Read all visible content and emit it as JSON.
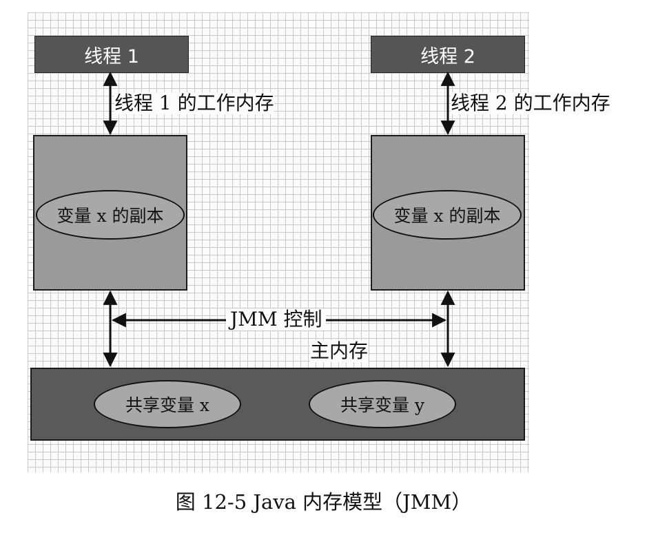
{
  "threads": [
    {
      "label": "线程 1"
    },
    {
      "label": "线程 2"
    }
  ],
  "working_memory_labels": [
    "线程 1 的工作内存",
    "线程 2 的工作内存"
  ],
  "copies": [
    "变量 x 的副本",
    "变量 x 的副本"
  ],
  "jmm_label": "JMM 控制",
  "main_memory_label": "主内存",
  "shared_vars": [
    "共享变量 x",
    "共享变量 y"
  ],
  "caption": "图 12-5    Java 内存模型（JMM）"
}
